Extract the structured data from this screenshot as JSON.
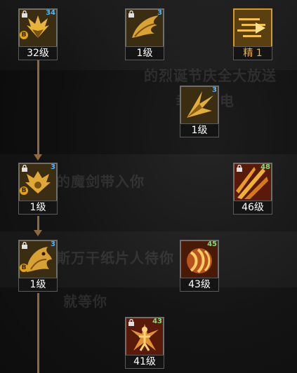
{
  "background_text": [
    "的烈诞节庆全大放送",
    "幸福来电",
    "的魔剑带入你",
    "斯万干纸片人待你",
    "就等你"
  ],
  "skills": [
    {
      "id": "skill-1",
      "level": "32级",
      "badge": "34",
      "badge_color": "blue",
      "locked": true,
      "b_badge": "B",
      "key": "A",
      "frame": "gray",
      "art": "wings",
      "elite": false
    },
    {
      "id": "skill-2",
      "level": "1级",
      "badge": "3",
      "badge_color": "blue",
      "locked": true,
      "b_badge": "",
      "key": "",
      "frame": "gray",
      "art": "wing",
      "elite": false
    },
    {
      "id": "skill-3",
      "level": "精  1",
      "badge": "",
      "badge_color": "",
      "locked": false,
      "b_badge": "",
      "key": "",
      "frame": "gold",
      "art": "dash",
      "elite": true,
      "clock": true
    },
    {
      "id": "skill-4",
      "level": "1级",
      "badge": "3",
      "badge_color": "blue",
      "locked": false,
      "b_badge": "",
      "key": "",
      "frame": "gray",
      "art": "burst",
      "elite": false,
      "clock": true
    },
    {
      "id": "skill-5",
      "level": "1级",
      "badge": "3",
      "badge_color": "blue",
      "locked": true,
      "b_badge": "B",
      "key": "Q",
      "frame": "gray",
      "art": "wings2",
      "elite": false
    },
    {
      "id": "skill-6",
      "level": "46级",
      "badge": "48",
      "badge_color": "green",
      "locked": true,
      "b_badge": "",
      "key": "S",
      "frame": "gray",
      "art": "slash",
      "elite": false
    },
    {
      "id": "skill-7",
      "level": "1级",
      "badge": "3",
      "badge_color": "blue",
      "locked": true,
      "b_badge": "B",
      "key": "D",
      "frame": "gray",
      "art": "dragon",
      "elite": false
    },
    {
      "id": "skill-8",
      "level": "43级",
      "badge": "45",
      "badge_color": "green",
      "locked": false,
      "b_badge": "",
      "key": "E",
      "frame": "gray",
      "art": "claw",
      "elite": false
    },
    {
      "id": "skill-9",
      "level": "41级",
      "badge": "43",
      "badge_color": "green",
      "locked": true,
      "b_badge": "",
      "key": "F",
      "frame": "gray",
      "art": "figure",
      "elite": false
    }
  ],
  "colors": {
    "connector": "#8a6a3e",
    "badge_blue": "#4fb5ff",
    "badge_green": "#7be07b",
    "elite_gold": "#f2b12e",
    "key_red": "#cf1f1f",
    "b_gold": "#e2a40f"
  }
}
